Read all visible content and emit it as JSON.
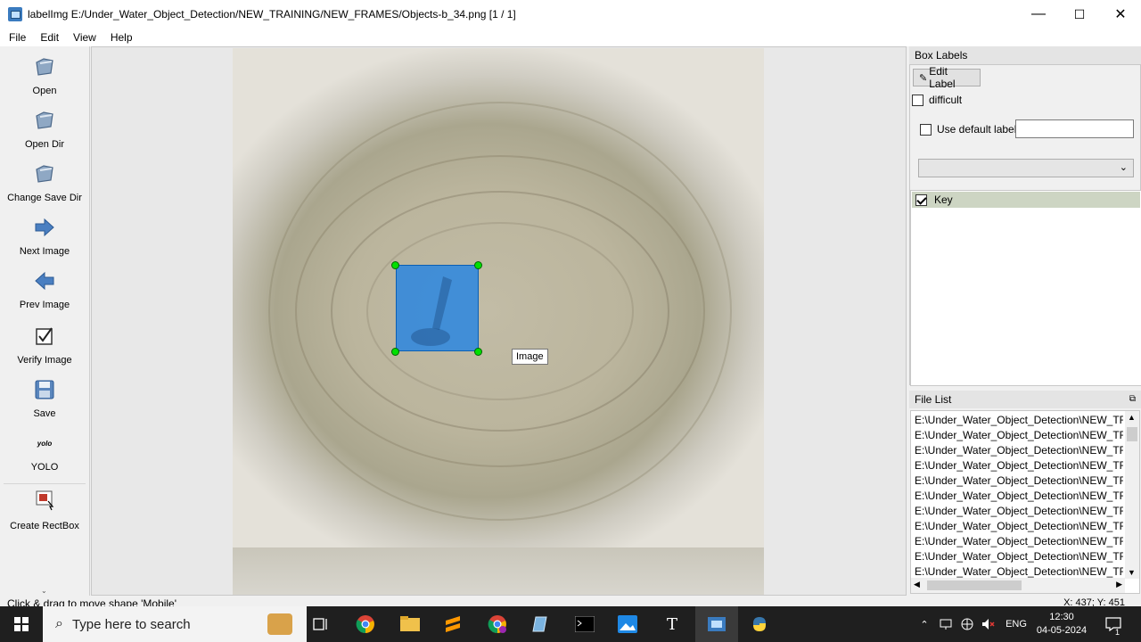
{
  "window": {
    "title": "labelImg E:/Under_Water_Object_Detection/NEW_TRAINING/NEW_FRAMES/Objects-b_34.png [1 / 1]",
    "minimize": "—",
    "maximize": "☐",
    "close": "✕"
  },
  "menu": {
    "file": "File",
    "edit": "Edit",
    "view": "View",
    "help": "Help"
  },
  "toolbar": {
    "open": "Open",
    "open_dir": "Open Dir",
    "change_save_dir": "Change Save Dir",
    "next_image": "Next Image",
    "prev_image": "Prev Image",
    "verify_image": "Verify Image",
    "save": "Save",
    "yolo_icon_text": "yolo",
    "yolo": "YOLO",
    "create_rectbox": "Create RectBox"
  },
  "canvas": {
    "tooltip": "Image"
  },
  "box_labels": {
    "title": "Box Labels",
    "edit_label": "Edit Label",
    "difficult": "difficult",
    "difficult_checked": false,
    "use_default_label": "Use default label",
    "use_default_checked": false,
    "default_label_value": "",
    "combo_value": "",
    "labels": [
      {
        "text": "Key",
        "checked": true
      }
    ]
  },
  "file_list": {
    "title": "File List",
    "items": [
      "E:\\Under_Water_Object_Detection\\NEW_TRA",
      "E:\\Under_Water_Object_Detection\\NEW_TRA",
      "E:\\Under_Water_Object_Detection\\NEW_TRA",
      "E:\\Under_Water_Object_Detection\\NEW_TRA",
      "E:\\Under_Water_Object_Detection\\NEW_TRA",
      "E:\\Under_Water_Object_Detection\\NEW_TRA",
      "E:\\Under_Water_Object_Detection\\NEW_TRA",
      "E:\\Under_Water_Object_Detection\\NEW_TRA",
      "E:\\Under_Water_Object_Detection\\NEW_TRA",
      "E:\\Under_Water_Object_Detection\\NEW_TRA",
      "E:\\Under_Water_Object_Detection\\NEW_TRA"
    ]
  },
  "status": {
    "message": "Click & drag to move shape 'Mobile'",
    "coords": "X: 437; Y: 451"
  },
  "taskbar": {
    "search_placeholder": "Type here to search",
    "language": "ENG",
    "time": "12:30",
    "date": "04-05-2024",
    "notification_count": "1"
  },
  "colors": {
    "bbox_fill": "#1e82e6",
    "handle": "#00e000",
    "selected_label_bg": "#cdd5c3",
    "taskbar": "#1f1f1f"
  }
}
